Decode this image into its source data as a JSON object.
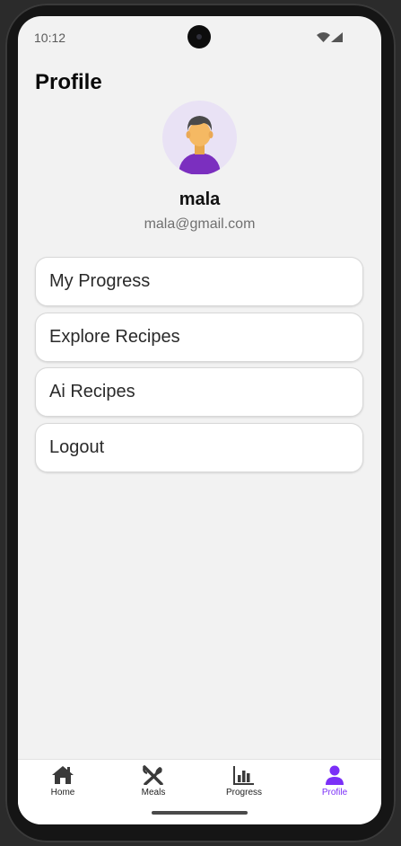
{
  "status": {
    "time": "10:12"
  },
  "header": {
    "title": "Profile"
  },
  "profile": {
    "name": "mala",
    "email": "mala@gmail.com"
  },
  "menu": [
    {
      "label": "My Progress"
    },
    {
      "label": "Explore Recipes"
    },
    {
      "label": "Ai Recipes"
    },
    {
      "label": "Logout"
    }
  ],
  "bottom_nav": [
    {
      "label": "Home",
      "icon": "home-icon",
      "active": false
    },
    {
      "label": "Meals",
      "icon": "utensils-icon",
      "active": false
    },
    {
      "label": "Progress",
      "icon": "bar-chart-icon",
      "active": false
    },
    {
      "label": "Profile",
      "icon": "person-icon",
      "active": true
    }
  ],
  "colors": {
    "accent": "#7b2ff7",
    "background": "#f2f2f2",
    "avatar_bg": "#e9e2f5"
  }
}
